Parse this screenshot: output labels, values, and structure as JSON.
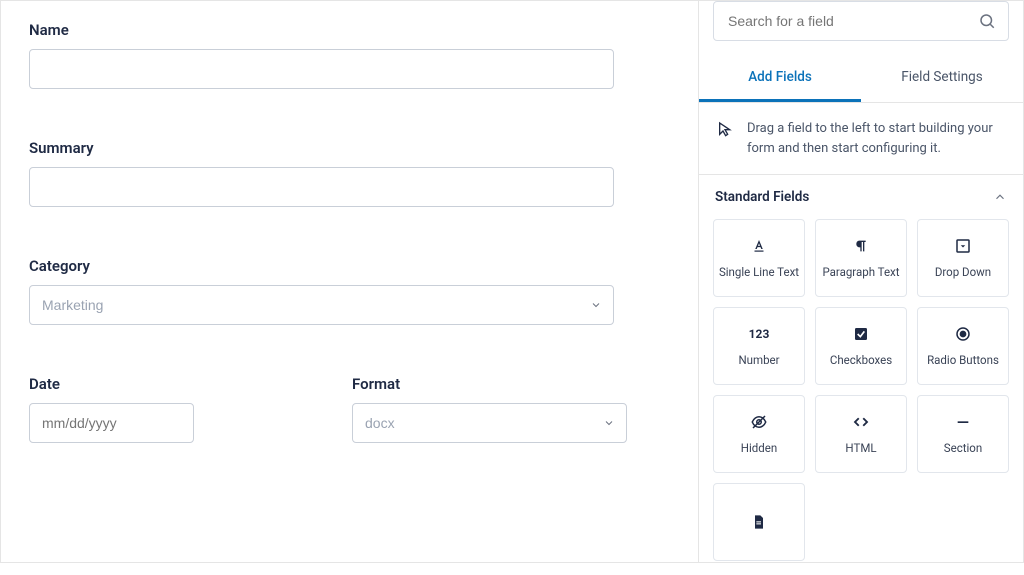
{
  "form": {
    "name_label": "Name",
    "name_value": "",
    "summary_label": "Summary",
    "summary_value": "",
    "category_label": "Category",
    "category_value": "Marketing",
    "date_label": "Date",
    "date_placeholder": "mm/dd/yyyy",
    "format_label": "Format",
    "format_value": "docx"
  },
  "sidebar": {
    "search_placeholder": "Search for a field",
    "tabs": {
      "add_fields": "Add Fields",
      "field_settings": "Field Settings"
    },
    "hint": "Drag a field to the left to start building your form and then start configuring it.",
    "standard_fields_title": "Standard Fields",
    "tiles": {
      "single_line": "Single Line Text",
      "paragraph": "Paragraph Text",
      "dropdown": "Drop Down",
      "number": "Number",
      "checkboxes": "Checkboxes",
      "radio": "Radio Buttons",
      "hidden": "Hidden",
      "html": "HTML",
      "section": "Section"
    }
  }
}
